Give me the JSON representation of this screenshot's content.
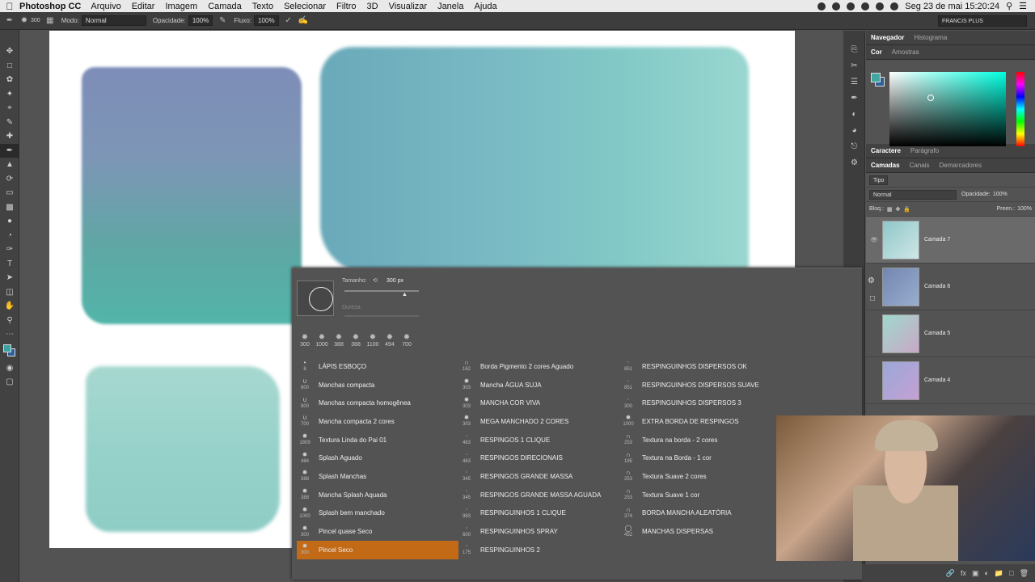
{
  "menubar": {
    "app": "Photoshop CC",
    "items": [
      "Arquivo",
      "Editar",
      "Imagem",
      "Camada",
      "Texto",
      "Selecionar",
      "Filtro",
      "3D",
      "Visualizar",
      "Janela",
      "Ajuda"
    ],
    "clock": "Seg 23 de mai  15:20:24"
  },
  "options": {
    "brush_size": "300",
    "mode_label": "Modo:",
    "mode_value": "Normal",
    "opacity_label": "Opacidade:",
    "opacity_value": "100%",
    "flow_label": "Fluxo:",
    "flow_value": "100%",
    "workspace": "FRANCIS PLUS"
  },
  "tools": [
    "move",
    "marquee",
    "lasso",
    "quick-select",
    "crop",
    "eyedropper",
    "healing",
    "brush",
    "stamp",
    "history-brush",
    "eraser",
    "gradient",
    "blur",
    "dodge",
    "pen",
    "type",
    "path-select",
    "shape",
    "hand",
    "zoom",
    "more"
  ],
  "colors": {
    "foreground": "#3aa3a0",
    "background": "#2e5f9a",
    "accent": "#c26a16"
  },
  "right_panels": {
    "tabs_top": [
      "Navegador",
      "Histograma"
    ],
    "tabs_color": [
      "Cor",
      "Amostras"
    ],
    "tabs_char": [
      "Caractere",
      "Parágrafo"
    ],
    "tabs_layers": [
      "Camadas",
      "Canais",
      "Demarcadores"
    ],
    "layer_filter": "Tipo",
    "blend_mode": "Normal",
    "opacity_label": "Opacidade:",
    "opacity_value": "100%",
    "lock_label": "Bloq.:",
    "fill_label": "Preen.:",
    "fill_value": "100%",
    "layers": [
      {
        "name": "Camada 7",
        "selected": true
      },
      {
        "name": "Camada 6",
        "selected": false
      },
      {
        "name": "Camada 5",
        "selected": false
      },
      {
        "name": "Camada 4",
        "selected": false
      }
    ]
  },
  "brush_picker": {
    "size_label": "Tamanho:",
    "size_value": "300 px",
    "hardness_label": "Dureza:",
    "recent": [
      "300",
      "1000",
      "388",
      "388",
      "1100",
      "494",
      "700"
    ],
    "columns": [
      [
        {
          "num": "8",
          "name": "LÁPIS ESBOÇO"
        },
        {
          "num": "800",
          "name": "Manchas compacta"
        },
        {
          "num": "800",
          "name": "Manchas compacta homogênea"
        },
        {
          "num": "700",
          "name": "Mancha compacta 2 cores"
        },
        {
          "num": "1809",
          "name": "Textura Linda do Pai 01"
        },
        {
          "num": "484",
          "name": "Splash Aguado"
        },
        {
          "num": "388",
          "name": "Splash Manchas"
        },
        {
          "num": "388",
          "name": "Mancha Splash Aquada"
        },
        {
          "num": "1000",
          "name": "Splash bem manchado"
        },
        {
          "num": "300",
          "name": "Pincel quase Seco"
        },
        {
          "num": "300",
          "name": "Pincel Seco",
          "selected": true
        }
      ],
      [
        {
          "num": "162",
          "name": "Borda Pigmento 2 cores Aguado"
        },
        {
          "num": "303",
          "name": "Mancha ÁGUA SUJA"
        },
        {
          "num": "303",
          "name": "MANCHA COR VIVA"
        },
        {
          "num": "303",
          "name": "MEGA MANCHADO 2 CORES"
        },
        {
          "num": "463",
          "name": "RESPINGOS 1 CLIQUE"
        },
        {
          "num": "463",
          "name": "RESPINGOS DIRECIONAIS"
        },
        {
          "num": "345",
          "name": "RESPINGOS GRANDE MASSA"
        },
        {
          "num": "345",
          "name": "RESPINGOS GRANDE MASSA AGUADA"
        },
        {
          "num": "983",
          "name": "RESPINGUINHOS 1 CLIQUE"
        },
        {
          "num": "600",
          "name": "RESPINGUINHOS SPRAY"
        },
        {
          "num": "175",
          "name": "RESPINGUINHOS 2"
        }
      ],
      [
        {
          "num": "851",
          "name": "RESPINGUINHOS DISPERSOS OK"
        },
        {
          "num": "851",
          "name": "RESPINGUINHOS DISPERSOS SUAVE"
        },
        {
          "num": "300",
          "name": "RESPINGUINHOS DISPERSOS 3"
        },
        {
          "num": "1000",
          "name": "EXTRA BORDA DE RESPINGOS"
        },
        {
          "num": "253",
          "name": "Textura na borda - 2 cores"
        },
        {
          "num": "195",
          "name": "Textura na Borda - 1 cor"
        },
        {
          "num": "253",
          "name": "Textura Suave 2 cores"
        },
        {
          "num": "253",
          "name": "Textura Suave 1 cor"
        },
        {
          "num": "374",
          "name": "BORDA MANCHA ALEATÓRIA"
        },
        {
          "num": "452",
          "name": "MANCHAS DISPERSAS"
        }
      ]
    ]
  }
}
